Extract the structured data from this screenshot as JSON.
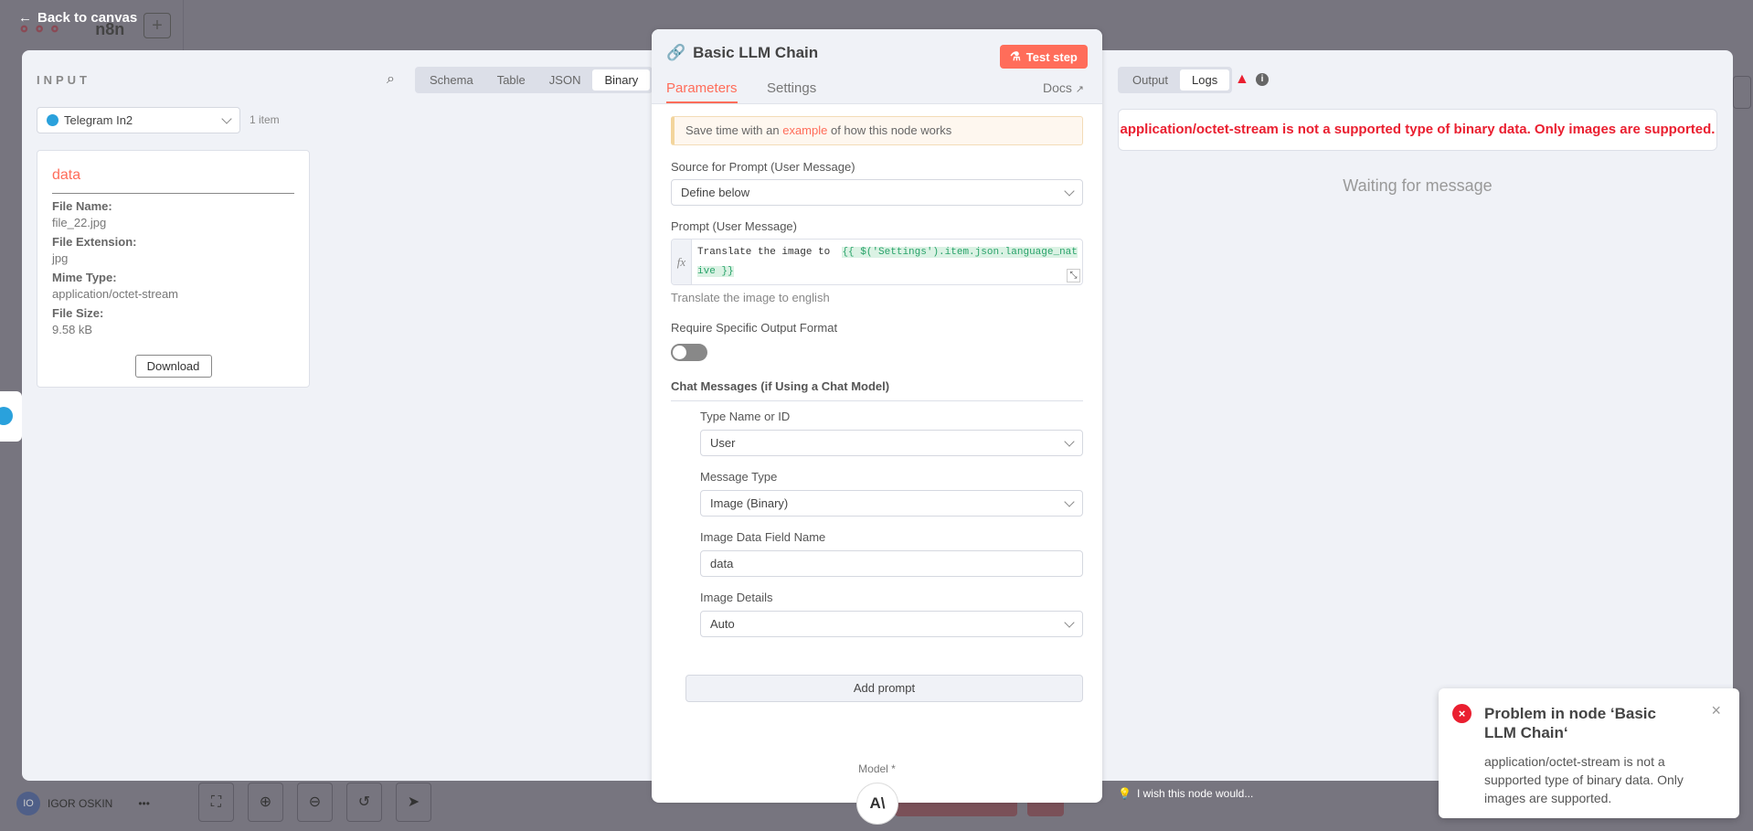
{
  "topbar": {
    "back_label": "Back to canvas",
    "logo_text": "n8n",
    "add_label": "+"
  },
  "input": {
    "title": "INPUT",
    "views": [
      "Schema",
      "Table",
      "JSON",
      "Binary"
    ],
    "active_view": "Binary",
    "source_node": "Telegram In2",
    "item_count": "1 item",
    "card": {
      "name": "data",
      "fields": [
        {
          "k": "File Name:",
          "v": "file_22.jpg"
        },
        {
          "k": "File Extension:",
          "v": "jpg"
        },
        {
          "k": "Mime Type:",
          "v": "application/octet-stream"
        },
        {
          "k": "File Size:",
          "v": "9.58 kB"
        }
      ],
      "download_label": "Download"
    }
  },
  "node": {
    "title": "Basic LLM Chain",
    "test_label": "Test step",
    "tabs": {
      "parameters": "Parameters",
      "settings": "Settings",
      "docs": "Docs"
    },
    "callout": {
      "pre": "Save time with an ",
      "link": "example",
      "post": " of how this node works"
    },
    "source_label": "Source for Prompt (User Message)",
    "source_value": "Define below",
    "prompt_label": "Prompt (User Message)",
    "prompt_text": "Translate the image to  ",
    "prompt_expr1": "{{ $('Settings').item.json.language_nat",
    "prompt_expr2": "ive }}",
    "prompt_preview": "Translate the image to  english",
    "require_label": "Require Specific Output Format",
    "require_on": false,
    "chat_header": "Chat Messages (if Using a Chat Model)",
    "type_label": "Type Name or ID",
    "type_value": "User",
    "msg_type_label": "Message Type",
    "msg_type_value": "Image (Binary)",
    "field_label": "Image Data Field Name",
    "field_value": "data",
    "details_label": "Image Details",
    "details_value": "Auto",
    "add_prompt": "Add prompt",
    "model_label": "Model *",
    "fx": "fx"
  },
  "output": {
    "tabs": [
      "Output",
      "Logs"
    ],
    "active": "Logs",
    "error": "application/octet-stream is not a supported type of binary data. Only images are supported.",
    "waiting": "Waiting for message"
  },
  "toast": {
    "title": "Problem in node ‘Basic LLM Chain‘",
    "message": "application/octet-stream is not a supported type of binary data. Only images are supported."
  },
  "footer": {
    "user_initials": "IO",
    "user_name": "IGOR OSKIN",
    "more": "•••",
    "feedback": "I wish this node would..."
  },
  "colors": {
    "accent": "#ff6d5a",
    "error": "#ea1f30",
    "expr": "#29a36a"
  }
}
